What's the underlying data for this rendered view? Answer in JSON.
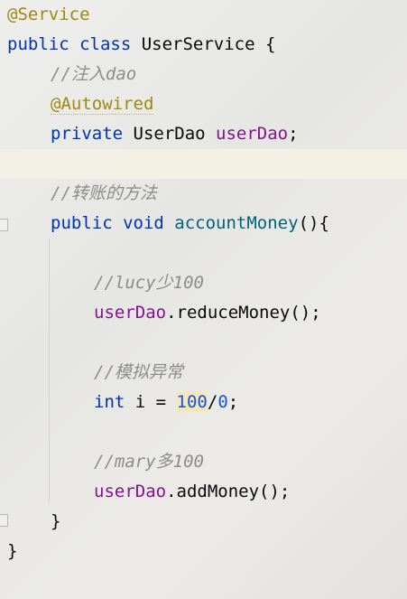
{
  "editor": {
    "lines": [
      [
        {
          "t": "@Service",
          "c": "ann"
        }
      ],
      [
        {
          "t": "public ",
          "c": "kw"
        },
        {
          "t": "class ",
          "c": "kw"
        },
        {
          "t": "UserService {",
          "c": "plain"
        }
      ],
      [
        {
          "t": "//注入dao",
          "c": "comment"
        }
      ],
      [
        {
          "t": "@Autowired",
          "c": "ann-warn"
        }
      ],
      [
        {
          "t": "private ",
          "c": "kw"
        },
        {
          "t": "UserDao ",
          "c": "plain"
        },
        {
          "t": "userDao",
          "c": "field"
        },
        {
          "t": ";",
          "c": "plain"
        }
      ],
      [],
      [
        {
          "t": "//转账的方法",
          "c": "comment"
        }
      ],
      [
        {
          "t": "public ",
          "c": "kw"
        },
        {
          "t": "void ",
          "c": "kw"
        },
        {
          "t": "accountMoney",
          "c": "method"
        },
        {
          "t": "(){",
          "c": "plain"
        }
      ],
      [],
      [
        {
          "t": "//lucy少100",
          "c": "comment"
        }
      ],
      [
        {
          "t": "userDao",
          "c": "field"
        },
        {
          "t": ".reduceMoney();",
          "c": "plain"
        }
      ],
      [],
      [
        {
          "t": "//模拟异常",
          "c": "comment"
        }
      ],
      [
        {
          "t": "int ",
          "c": "kw"
        },
        {
          "t": "i = ",
          "c": "plain"
        },
        {
          "t": "100",
          "c": "num-hl"
        },
        {
          "t": "/",
          "c": "plain"
        },
        {
          "t": "0",
          "c": "num"
        },
        {
          "t": ";",
          "c": "plain"
        }
      ],
      [],
      [
        {
          "t": "//mary多100",
          "c": "comment"
        }
      ],
      [
        {
          "t": "userDao",
          "c": "field"
        },
        {
          "t": ".addMoney();",
          "c": "plain"
        }
      ],
      [
        {
          "t": "}",
          "c": "plain"
        }
      ],
      [
        {
          "t": "}",
          "c": "plain"
        }
      ]
    ],
    "current_line": 5
  }
}
